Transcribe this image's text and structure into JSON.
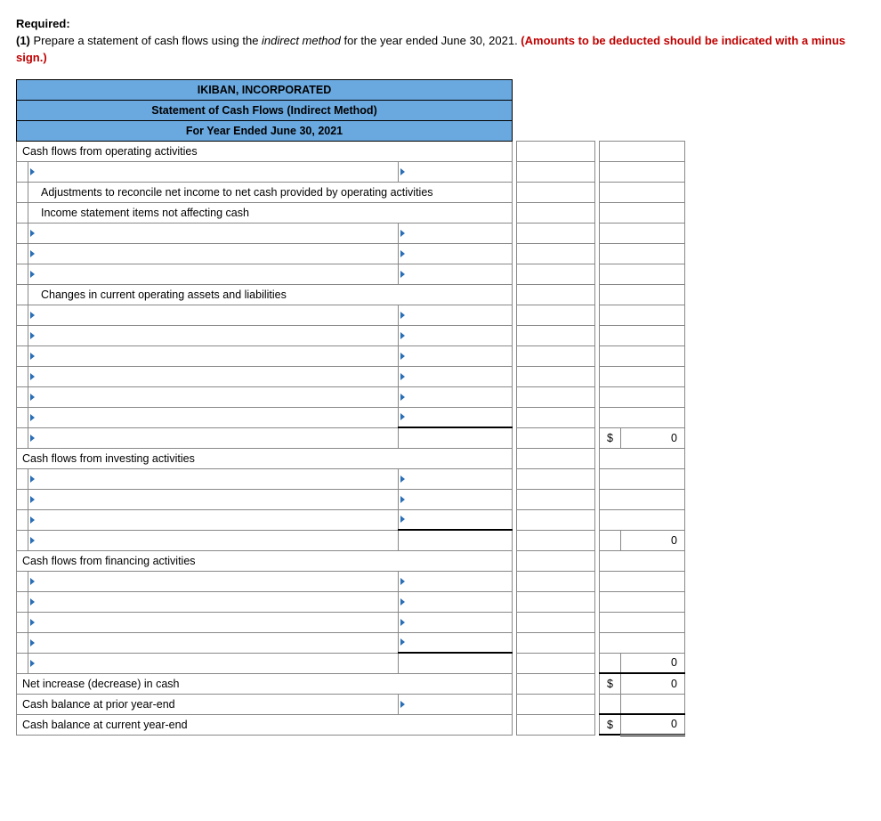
{
  "instructions": {
    "required_label": "Required:",
    "item_num": "(1)",
    "text_a": " Prepare a statement of cash flows using the ",
    "italic_phrase": "indirect method",
    "text_b": " for the year ended June 30, 2021. ",
    "red_text": "(Amounts to be deducted should be indicated with a minus sign.)"
  },
  "header": {
    "company": "IKIBAN, INCORPORATED",
    "title": "Statement of Cash Flows (Indirect Method)",
    "period": "For Year Ended June 30, 2021"
  },
  "labels": {
    "op_section": "Cash flows from operating activities",
    "adjustments": "Adjustments to reconcile net income to net cash provided by operating activities",
    "income_items": "Income statement items not affecting cash",
    "changes": "Changes in current operating assets and liabilities",
    "inv_section": "Cash flows from investing activities",
    "fin_section": "Cash flows from financing activities",
    "net_inc": "Net increase (decrease) in cash",
    "prior_bal": "Cash balance at prior year-end",
    "curr_bal": "Cash balance at current year-end"
  },
  "values": {
    "dollar": "$",
    "zero": "0"
  }
}
